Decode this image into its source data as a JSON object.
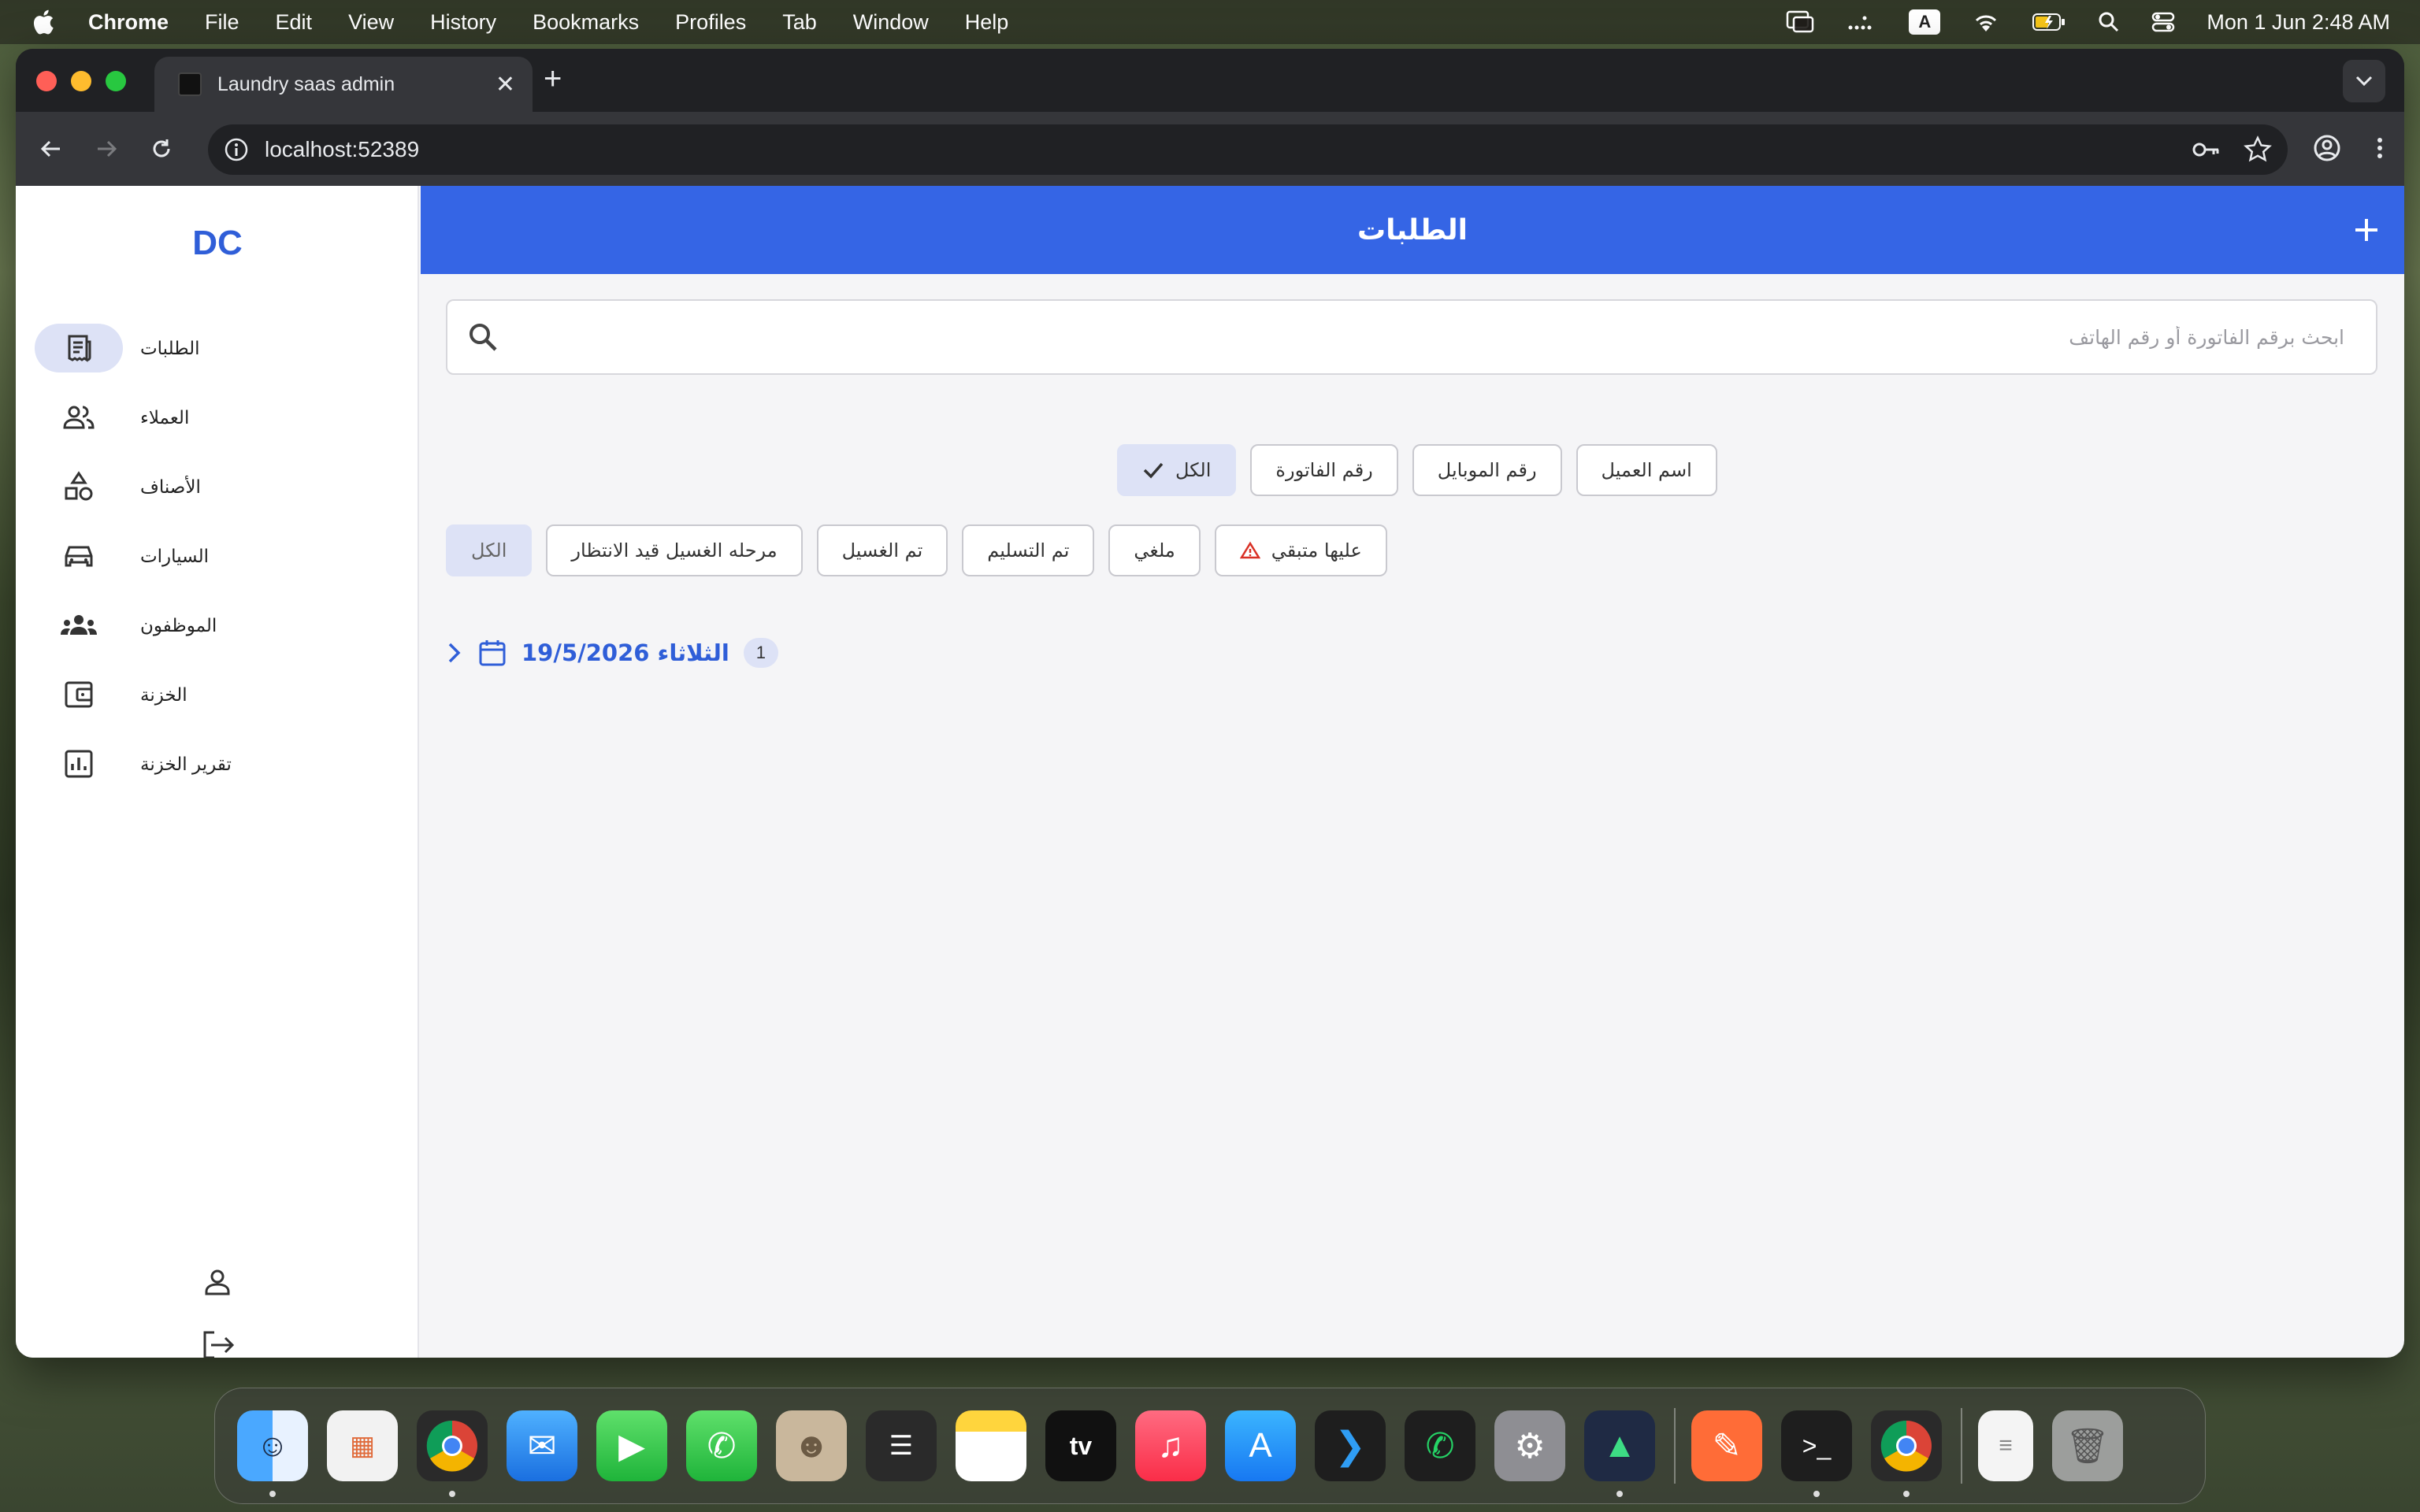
{
  "menubar": {
    "app_name": "Chrome",
    "items": [
      "File",
      "Edit",
      "View",
      "History",
      "Bookmarks",
      "Profiles",
      "Tab",
      "Window",
      "Help"
    ],
    "clock": "Mon 1 Jun  2:48 AM",
    "input_badge": "A"
  },
  "browser": {
    "tab_title": "Laundry saas admin",
    "url": "localhost:52389"
  },
  "sidebar": {
    "logo": "DC",
    "items": [
      {
        "label": "الطلبات",
        "icon": "receipt-icon",
        "active": true
      },
      {
        "label": "العملاء",
        "icon": "people-icon",
        "active": false
      },
      {
        "label": "الأصناف",
        "icon": "category-icon",
        "active": false
      },
      {
        "label": "السيارات",
        "icon": "car-icon",
        "active": false
      },
      {
        "label": "الموظفون",
        "icon": "groups-icon",
        "active": false
      },
      {
        "label": "الخزنة",
        "icon": "wallet-icon",
        "active": false
      },
      {
        "label": "تقرير الخزنة",
        "icon": "bar-chart-icon",
        "active": false
      }
    ]
  },
  "header": {
    "title": "الطلبات"
  },
  "search": {
    "placeholder": "ابحث برقم الفاتورة أو رقم الهاتف",
    "value": ""
  },
  "search_filters": {
    "options": [
      "اسم العميل",
      "رقم الموبايل",
      "رقم الفاتورة",
      "الكل"
    ],
    "selected": "الكل"
  },
  "status_filters": {
    "options": [
      "عليها متبقي",
      "ملغي",
      "تم التسليم",
      "تم الغسيل",
      "مرحله الغسيل قيد الانتظار",
      "الكل"
    ],
    "selected": "الكل"
  },
  "order_groups": [
    {
      "date": "الثلاثاء 19/5/2026",
      "count": "1"
    }
  ],
  "colors": {
    "primary": "#3565e5",
    "accent_text": "#2f5ed8",
    "selected_chip": "#dde2f6",
    "warning": "#d93025"
  },
  "dock": {
    "apps": [
      "finder-icon",
      "launchpad-icon",
      "chrome-icon",
      "mail-icon",
      "facetime-icon",
      "phone-icon",
      "contacts-icon",
      "reminders-icon",
      "notes-icon",
      "apple-tv-icon",
      "music-icon",
      "app-store-icon",
      "vscode-icon",
      "whatsapp-icon",
      "system-settings-icon",
      "android-studio-icon",
      "postman-icon",
      "terminal-icon",
      "chrome-icon-2",
      "document-icon",
      "trash-icon"
    ],
    "tv_label": "tv"
  }
}
